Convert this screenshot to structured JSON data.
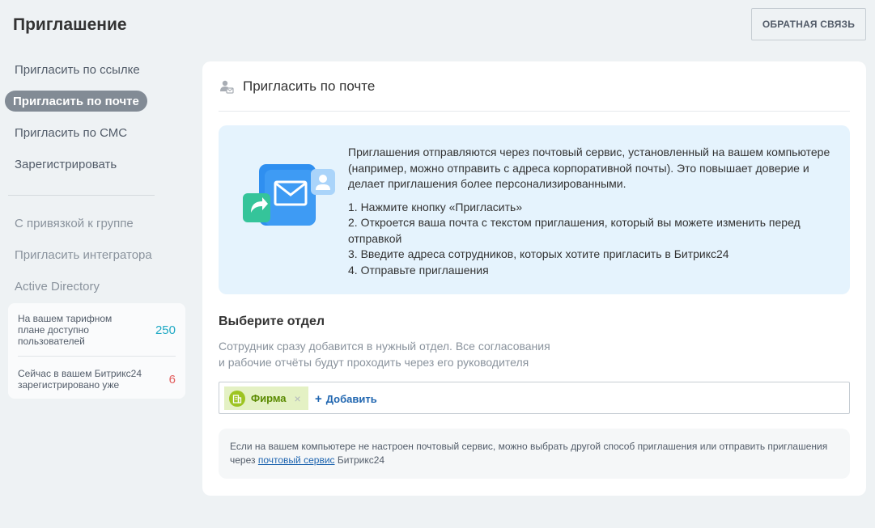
{
  "header": {
    "title": "Приглашение",
    "feedback_button": "ОБРАТНАЯ СВЯЗЬ"
  },
  "sidebar": {
    "items": [
      {
        "label": "Пригласить по ссылке",
        "active": false
      },
      {
        "label": "Пригласить по почте",
        "active": true
      },
      {
        "label": "Пригласить по СМС",
        "active": false
      },
      {
        "label": "Зарегистрировать",
        "active": false
      }
    ],
    "secondary_items": [
      {
        "label": "С привязкой к группе"
      },
      {
        "label": "Пригласить интегратора"
      },
      {
        "label": "Active Directory"
      }
    ],
    "stats": [
      {
        "text": "На вашем тарифном плане доступно пользователей",
        "value": "250",
        "color": "#1fa9c4"
      },
      {
        "text": "Сейчас в вашем Битрикс24 зарегистрировано уже",
        "value": "6",
        "color": "#e25d5d"
      }
    ]
  },
  "main": {
    "title": "Пригласить по почте",
    "title_icon": "user-mail-icon",
    "info": {
      "intro": "Приглашения отправляются через почтовый сервис, установленный на вашем компьютере (например, можно отправить с адреса корпоративной почты). Это повышает доверие и делает приглашения более персонализированными.",
      "steps": [
        "1. Нажмите кнопку «Пригласить»",
        "2. Откроется ваша почта с текстом приглашения, который вы можете изменить перед отправкой",
        "3. Введите адреса сотрудников, которых хотите пригласить в Битрикс24",
        "4. Отправьте приглашения"
      ]
    },
    "department": {
      "title": "Выберите отдел",
      "description": "Сотрудник сразу добавится в нужный отдел. Все согласования и рабочие отчёты будут проходить через его руководителя",
      "tag_label": "Фирма",
      "tag_remove": "×",
      "add_plus": "+",
      "add_label": "Добавить"
    },
    "note": {
      "before": "Если на вашем компьютере не настроен почтовый сервис, можно выбрать другой способ приглашения или отправить приглашения через ",
      "link": "почтовый сервис",
      "after": " Битрикс24"
    }
  },
  "colors": {
    "accent": "#2066b0",
    "active_bg": "#828b95",
    "info_bg": "#e5f3fd",
    "tag_bg": "#e4f1c4",
    "tag_icon": "#9dc421"
  }
}
